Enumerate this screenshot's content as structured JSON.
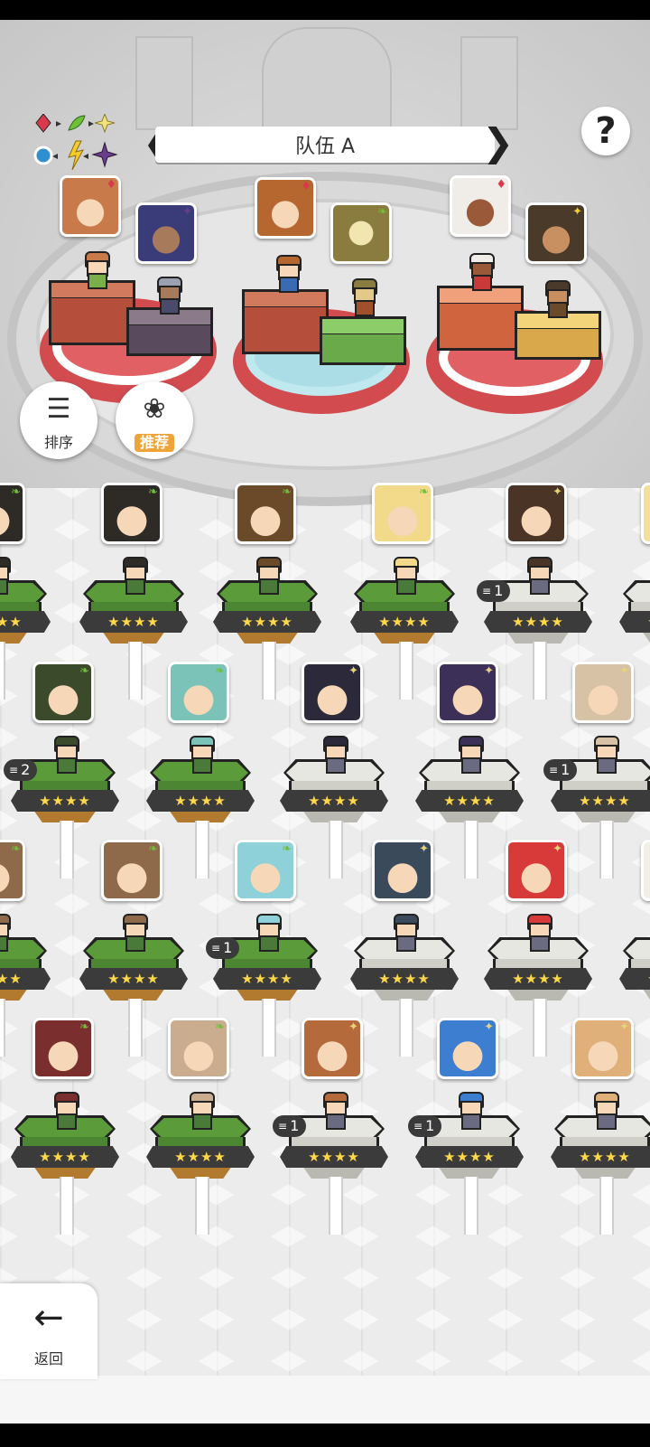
{
  "header": {
    "team_label": "队伍 A",
    "prev_icon": "chevron-left-icon",
    "next_icon": "chevron-right-icon",
    "help_glyph": "?"
  },
  "element_chart": {
    "icons": [
      "diamond-red",
      "leaf-green",
      "sparkle-yellow",
      "circle-blue",
      "bolt-yellow",
      "sparkle-purple"
    ]
  },
  "controls": {
    "sort_label": "排序",
    "recommend_label": "推荐"
  },
  "nav": {
    "back_label": "返回"
  },
  "team_slots": [
    {
      "element": "♦",
      "color": "#d24b4f",
      "front": "#e3a27c",
      "back": "#6e6a86"
    },
    {
      "element": "♦",
      "color": "#2f8fd0",
      "front": "#b5672f",
      "back": "#8a7b3e"
    },
    {
      "element": "♦",
      "color": "#d24b4f",
      "front": "#f0ece8",
      "back": "#4a3a2a"
    }
  ],
  "roster": {
    "star_text": "★★★★",
    "rows": [
      [
        {
          "element": "leaf",
          "face": "#2e2a26",
          "ped": "grass",
          "dupe": ""
        },
        {
          "element": "leaf",
          "face": "#6b4a2a",
          "ped": "grass",
          "dupe": ""
        },
        {
          "element": "leaf",
          "face": "#f3d98a",
          "ped": "grass",
          "dupe": ""
        },
        {
          "element": "spark",
          "face": "#4a3426",
          "ped": "stone",
          "dupe": "1"
        },
        {
          "element": "spark",
          "face": "#f4e09a",
          "ped": "stone",
          "dupe": ""
        }
      ],
      [
        {
          "element": "leaf",
          "face": "#3a4a2a",
          "ped": "grass",
          "dupe": "2"
        },
        {
          "element": "leaf",
          "face": "#7bc3b8",
          "ped": "grass",
          "dupe": ""
        },
        {
          "element": "spark",
          "face": "#2c2a3a",
          "ped": "stone",
          "dupe": ""
        },
        {
          "element": "spark",
          "face": "#3c2f58",
          "ped": "stone",
          "dupe": ""
        },
        {
          "element": "spark",
          "face": "#d7c2a6",
          "ped": "stone",
          "dupe": "1"
        }
      ],
      [
        {
          "element": "leaf",
          "face": "#8f6a4a",
          "ped": "grass",
          "dupe": ""
        },
        {
          "element": "leaf",
          "face": "#8fd1d8",
          "ped": "grass",
          "dupe": "1"
        },
        {
          "element": "spark",
          "face": "#3a4a5a",
          "ped": "stone",
          "dupe": ""
        },
        {
          "element": "spark",
          "face": "#d83a3a",
          "ped": "stone",
          "dupe": ""
        },
        {
          "element": "spark",
          "face": "#f2efe9",
          "ped": "stone",
          "dupe": ""
        }
      ],
      [
        {
          "element": "leaf",
          "face": "#7a2e2e",
          "ped": "grass",
          "dupe": ""
        },
        {
          "element": "leaf",
          "face": "#c9ad8e",
          "ped": "grass",
          "dupe": ""
        },
        {
          "element": "spark",
          "face": "#b46a3a",
          "ped": "stone",
          "dupe": "1"
        },
        {
          "element": "spark",
          "face": "#3d7ed0",
          "ped": "stone",
          "dupe": "1"
        },
        {
          "element": "spark",
          "face": "#e0b07a",
          "ped": "stone",
          "dupe": ""
        }
      ]
    ]
  }
}
